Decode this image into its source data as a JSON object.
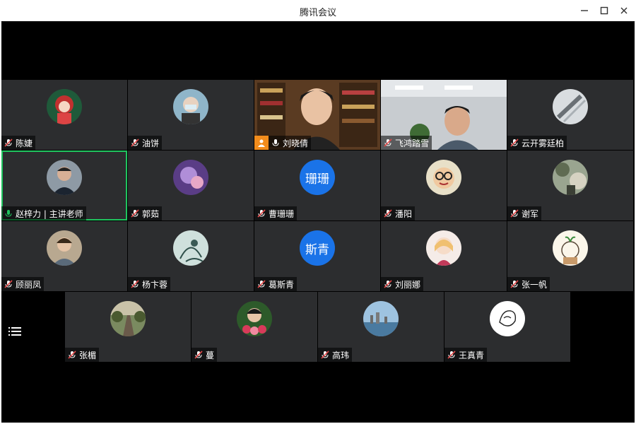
{
  "window": {
    "title": "腾讯会议"
  },
  "participants": [
    {
      "name": "陈婕",
      "mic": "muted",
      "avatar": "cartoon-girl-red-hat"
    },
    {
      "name": "油饼",
      "mic": "muted",
      "avatar": "masked-person-photo"
    },
    {
      "name": "刘晓倩",
      "mic": "on",
      "avatar": "live-video-bookshelf",
      "badge": "person-icon"
    },
    {
      "name": "飞鸿踏雪",
      "mic": "muted",
      "avatar": "live-video-office"
    },
    {
      "name": "云开雾廷柏",
      "mic": "muted",
      "avatar": "gray-abstract"
    },
    {
      "name": "赵梓力 | 主讲老师",
      "mic": "on",
      "avatar": "man-portrait",
      "active": true
    },
    {
      "name": "郭茹",
      "mic": "muted",
      "avatar": "purple-photo"
    },
    {
      "name": "曹珊珊",
      "mic": "muted",
      "avatar_text": "珊珊"
    },
    {
      "name": "潘阳",
      "mic": "muted",
      "avatar": "glasses-cartoon"
    },
    {
      "name": "谢军",
      "mic": "muted",
      "avatar": "outdoor-photo"
    },
    {
      "name": "顾丽凤",
      "mic": "muted",
      "avatar": "woman-photo"
    },
    {
      "name": "杨卞蓉",
      "mic": "muted",
      "avatar": "ink-painting"
    },
    {
      "name": "葛斯青",
      "mic": "muted",
      "avatar_text": "斯青"
    },
    {
      "name": "刘丽娜",
      "mic": "muted",
      "avatar": "doll-cartoon"
    },
    {
      "name": "张一帆",
      "mic": "muted",
      "avatar": "sprout-cartoon"
    },
    {
      "name": "张楣",
      "mic": "muted",
      "avatar": "road-landscape"
    },
    {
      "name": "蔓",
      "mic": "muted",
      "avatar": "girl-flowers"
    },
    {
      "name": "高玮",
      "mic": "muted",
      "avatar": "city-skyline"
    },
    {
      "name": "王真青",
      "mic": "muted",
      "avatar": "line-drawing"
    }
  ],
  "colors": {
    "active_border": "#1fc35e",
    "tile_bg": "#2c2d2f",
    "text_avatar": "#1a73e8",
    "muted_icon": "#e24a4a"
  }
}
